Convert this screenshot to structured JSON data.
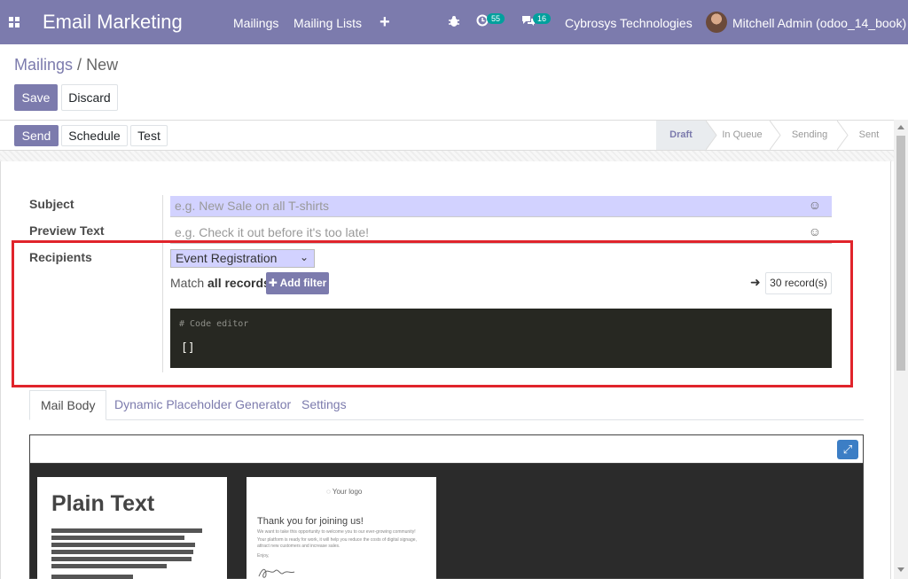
{
  "navbar": {
    "app_title": "Email Marketing",
    "menu": [
      "Mailings",
      "Mailing Lists"
    ],
    "activity_count": "55",
    "messages_count": "16",
    "company": "Cybrosys Technologies",
    "user": "Mitchell Admin (odoo_14_book)",
    "icons": [
      "apps-grid-icon",
      "plus-icon",
      "bug-icon",
      "activity-clock-icon",
      "chat-icon"
    ]
  },
  "breadcrumb": {
    "parent": "Mailings",
    "separator": "/",
    "current": "New"
  },
  "actions": {
    "save": "Save",
    "discard": "Discard"
  },
  "statusbar": {
    "buttons": {
      "send": "Send",
      "schedule": "Schedule",
      "test": "Test"
    },
    "stages": [
      "Draft",
      "In Queue",
      "Sending",
      "Sent"
    ],
    "active_stage": "Draft"
  },
  "form": {
    "subject_label": "Subject",
    "subject_placeholder": "e.g. New Sale on all T-shirts",
    "preview_label": "Preview Text",
    "preview_placeholder": "e.g. Check it out before it's too late!",
    "recipients_label": "Recipients",
    "recipients_value": "Event Registration",
    "match_prefix": "Match",
    "match_bold": "all records",
    "add_filter": "Add filter",
    "records": "30 record(s)",
    "code_comment": "# Code editor",
    "code_value": "[]"
  },
  "tabs": [
    "Mail Body",
    "Dynamic Placeholder Generator",
    "Settings"
  ],
  "active_tab": "Mail Body",
  "templates": {
    "plain_text_title": "Plain Text",
    "welcome_logo": "Your logo",
    "welcome_heading": "Thank you for joining us!",
    "welcome_line1": "We want to take this opportunity to welcome you to our ever-growing community!",
    "welcome_line2": "Your platform is ready for work, it will help you reduce the costs of digital signage, attract new customers and increase sales.",
    "welcome_regards": "Enjoy,"
  },
  "colors": {
    "brand": "#7c7bad",
    "highlight": "#e0242b",
    "required_field": "#d2d2ff",
    "code_bg": "#272822"
  }
}
